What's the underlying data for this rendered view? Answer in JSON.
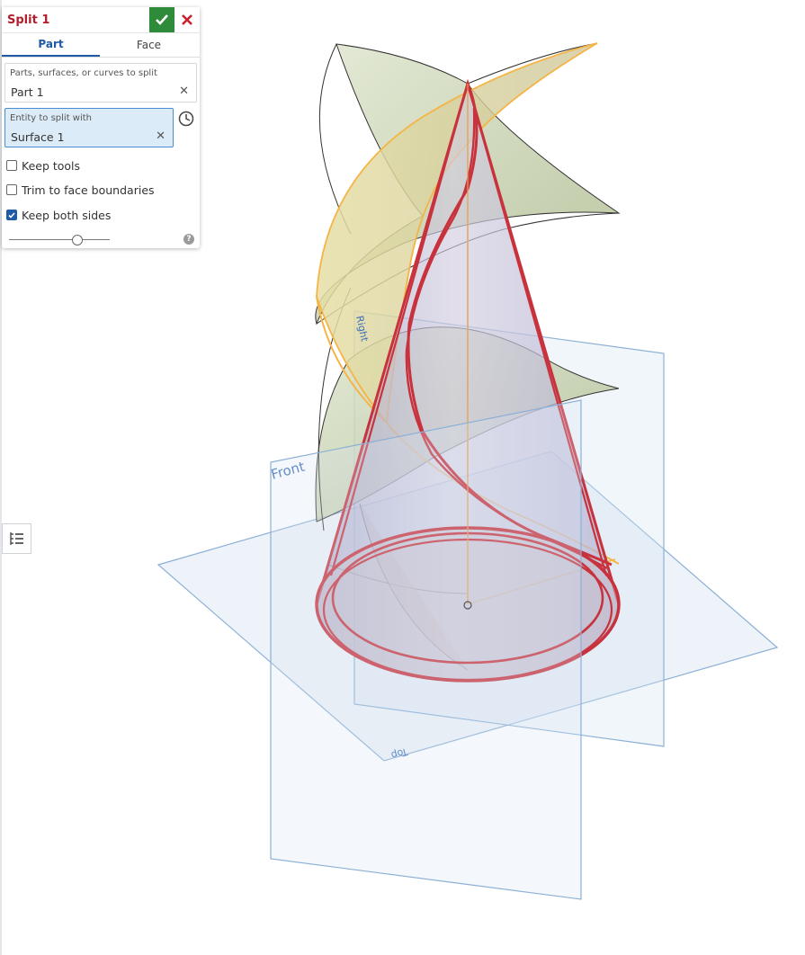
{
  "dialog": {
    "title": "Split 1",
    "tabs": [
      {
        "label": "Part"
      },
      {
        "label": "Face"
      }
    ],
    "parts_field": {
      "label": "Parts, surfaces, or curves to split",
      "value": "Part 1"
    },
    "entity_field": {
      "label": "Entity to split with",
      "value": "Surface 1"
    },
    "options": [
      {
        "label": "Keep tools",
        "checked": false
      },
      {
        "label": "Trim to face boundaries",
        "checked": false
      },
      {
        "label": "Keep both sides",
        "checked": true
      }
    ],
    "help_symbol": "?",
    "slider_value": 0.68
  },
  "viewport": {
    "plane_labels": {
      "front": "Front",
      "right": "Right",
      "top": "Top"
    }
  },
  "colors": {
    "title": "#b0202c",
    "accent": "#1e5ba8",
    "confirm": "#2e8b3a",
    "cancel": "#c8202c",
    "selection": "#c8323c",
    "plane": "#8cb0d6",
    "surface": "#c8d4a8",
    "highlight": "#f5b445"
  },
  "icons": [
    "check-icon",
    "close-icon",
    "clear-icon",
    "reselect-clock-icon",
    "help-icon",
    "feature-list-icon"
  ]
}
